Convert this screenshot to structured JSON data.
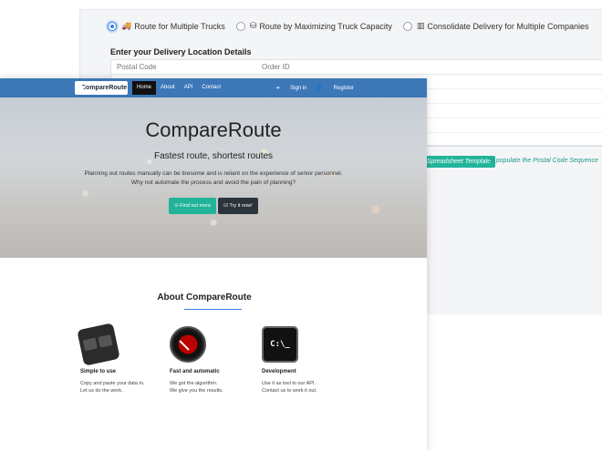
{
  "app": {
    "delivery_options": [
      {
        "label": "Route for Multiple Trucks",
        "icon": "truck-icon",
        "glyph": "🚚",
        "selected": true
      },
      {
        "label": "Route by Maximizing Truck Capacity",
        "icon": "cubes-icon",
        "glyph": "⛁",
        "selected": false
      },
      {
        "label": "Consolidate Delivery for Multiple Companies",
        "icon": "bar-chart-icon",
        "glyph": "▥",
        "selected": false
      }
    ],
    "section_title": "Enter your Delivery Location Details",
    "table_headers": [
      "Postal Code",
      "Order ID"
    ],
    "template_button": "Spreadsheet Template",
    "template_note": "to populate the Postal Code Sequence"
  },
  "landing": {
    "brand": "CompareRoute",
    "nav": [
      "Home",
      "About",
      "API",
      "Contact"
    ],
    "nav_right": [
      "Sign in",
      "Register"
    ],
    "hero_title": "CompareRoute",
    "hero_subtitle": "Fastest route, shortest routes",
    "hero_body_1": "Planning out routes manually can be tiresome and is reliant on the experience of senior personnel.",
    "hero_body_2": "Why not automate the process and avoid the pain of planning?",
    "btn_find": "Find out more",
    "btn_try": "Try it now!",
    "about_title": "About CompareRoute",
    "features": [
      {
        "title": "Simple to use",
        "desc_1": "Copy and paste your data in.",
        "desc_2": "Let us do the work.",
        "icon": "keyboard-keys-icon"
      },
      {
        "title": "Fast and automatic",
        "desc_1": "We got the algorithm.",
        "desc_2": "We give you the results.",
        "icon": "speedometer-icon"
      },
      {
        "title": "Development",
        "desc_1": "Use it as tool to our API.",
        "desc_2": "Contact us to work it out.",
        "icon": "terminal-icon",
        "glyph": "C:\\_"
      }
    ]
  },
  "colors": {
    "navbar": "#3c77b8",
    "accent_teal": "#22b49a",
    "link_blue": "#2f80ed"
  }
}
